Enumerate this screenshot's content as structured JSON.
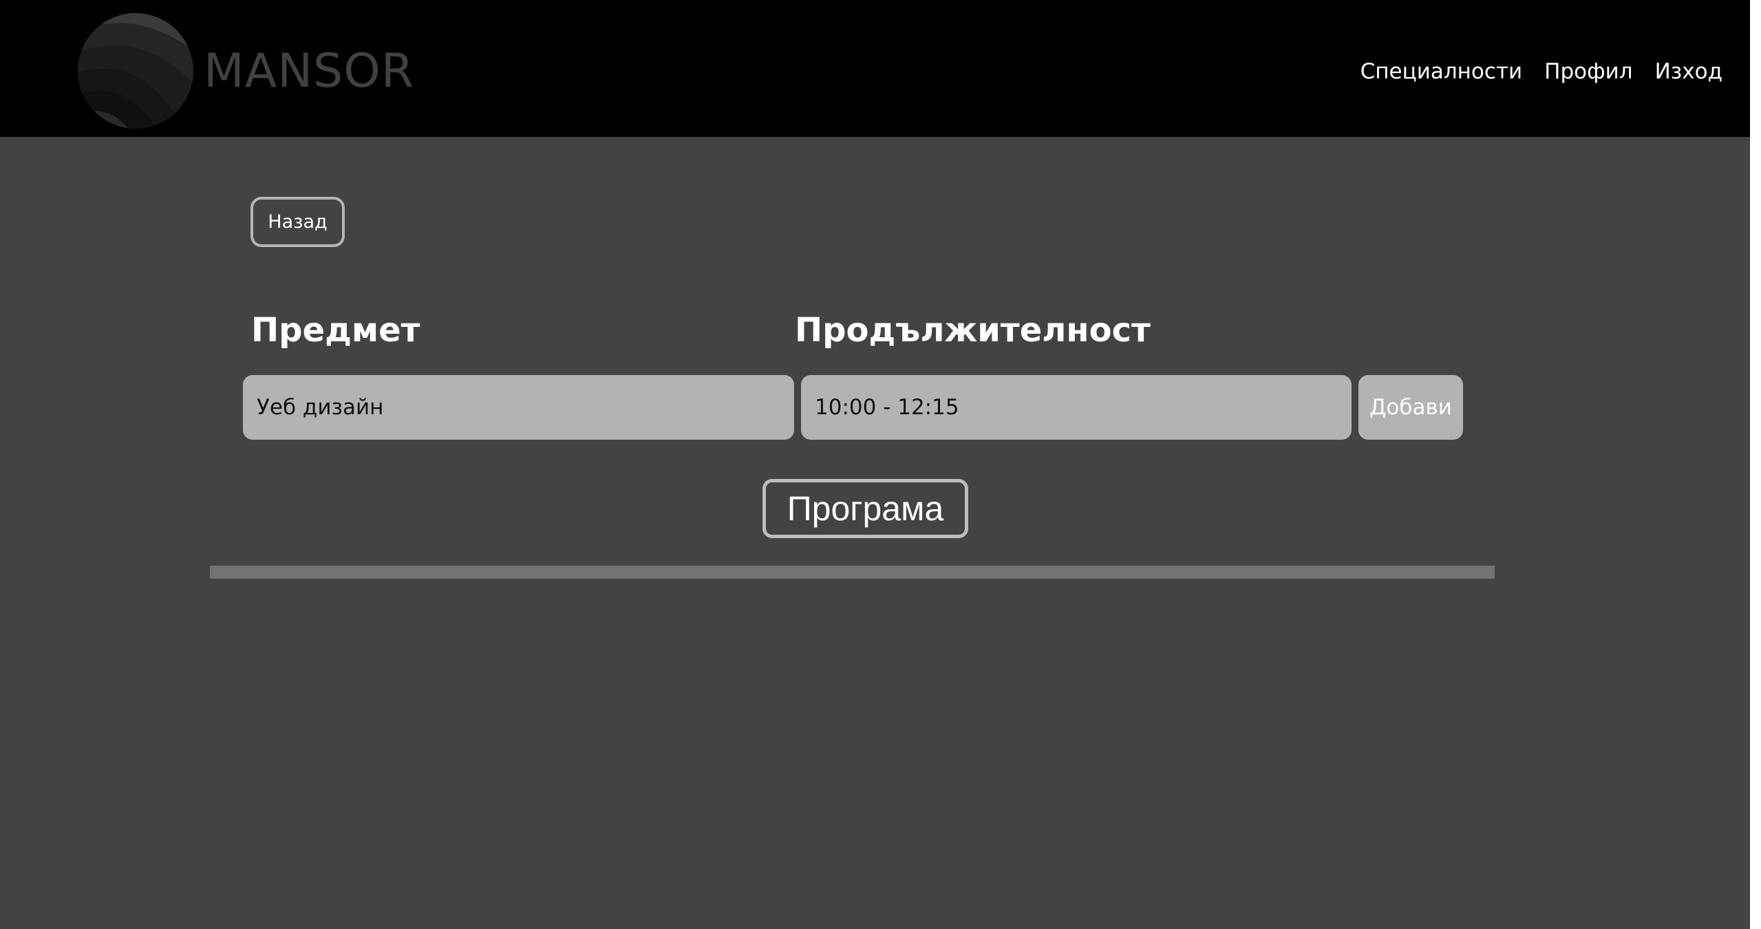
{
  "header": {
    "brand": "MANSOR",
    "logo_icon": "sphere-logo-icon",
    "nav": [
      {
        "label": "Специалности"
      },
      {
        "label": "Профил"
      },
      {
        "label": "Изход"
      }
    ]
  },
  "main": {
    "back_label": "Назад",
    "subject_heading": "Предмет",
    "duration_heading": "Продължителност",
    "subject_value": "Уеб дизайн",
    "duration_value": "10:00 - 12:15",
    "add_label": "Добави",
    "program_label": "Програма"
  },
  "colors": {
    "page_bg": "#434343",
    "header_bg": "#000000",
    "field_bg": "#b3b3b3",
    "divider": "#737373"
  }
}
